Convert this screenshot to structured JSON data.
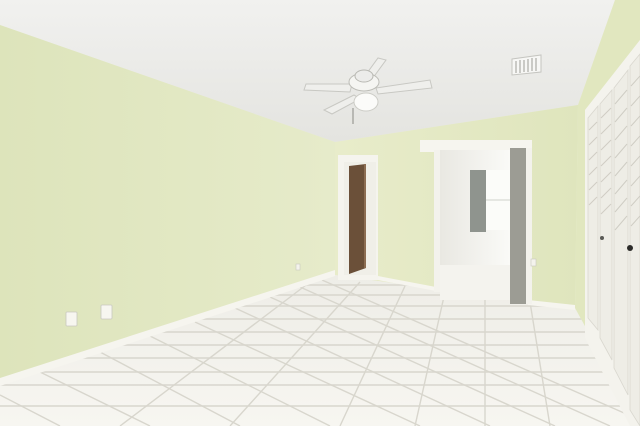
{
  "scene": {
    "kind": "photo",
    "subject": "empty room",
    "colors": {
      "ceiling": "#efefed",
      "wall_left": "#dfe5bf",
      "wall_back": "#e6ebc6",
      "wall_right": "#e3e8c3",
      "floor_tile": "#f2f1ec",
      "grout": "#d7d5cc",
      "door_wood": "#6b5039",
      "trim": "#f6f5ef",
      "window_light": "#fbfcf9",
      "curtain": "#8f948e"
    },
    "objects": [
      "ceiling-fan",
      "ceiling-light",
      "air-vent",
      "left-wall",
      "back-wall",
      "interior-door",
      "open-doorway",
      "window",
      "closet-louvered-doors",
      "electrical-outlet",
      "tile-floor",
      "baseboard"
    ]
  }
}
